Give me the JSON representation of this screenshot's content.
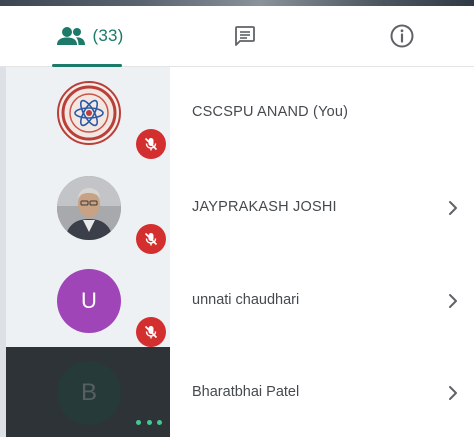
{
  "tabs": {
    "participants_count": "(33)",
    "chat_icon": "chat-icon",
    "info_icon": "info-icon",
    "people_icon": "people-icon"
  },
  "colors": {
    "accent": "#1b7a68",
    "mute_badge": "#d32f2f",
    "avatar_purple": "#9f45b8",
    "selected_row": "#2e3338",
    "panel": "#eef1f4"
  },
  "participants": [
    {
      "name": "CSCSPU ANAND (You)",
      "avatar": "university-emblem",
      "status": "mic-off-icon"
    },
    {
      "name": "JAYPRAKASH JOSHI",
      "avatar": "user-photo",
      "status": "mic-off-icon",
      "action": "chevron-right-icon"
    },
    {
      "name": "unnati chaudhari",
      "avatar_letter": "U",
      "status": "mic-off-icon",
      "action": "chevron-right-icon"
    },
    {
      "name": "Bharatbhai Patel",
      "avatar_letter": "B",
      "status": "speaking-dots",
      "action": "chevron-right-icon"
    }
  ]
}
